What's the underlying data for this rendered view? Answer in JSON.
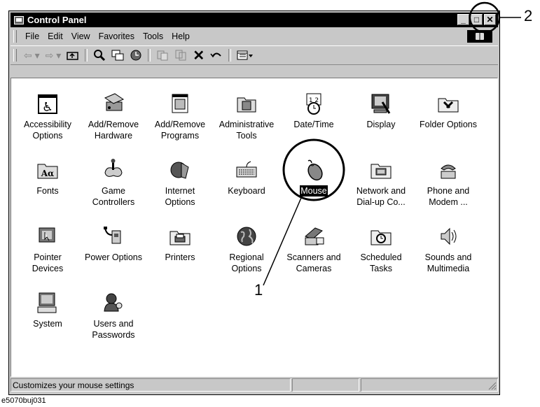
{
  "window": {
    "title": "Control Panel",
    "minimize_glyph": "_",
    "maximize_glyph": "□",
    "close_glyph": "✕"
  },
  "menu": [
    "File",
    "Edit",
    "View",
    "Favorites",
    "Tools",
    "Help"
  ],
  "toolbar": [
    "back-icon",
    "forward-icon",
    "up-folder-icon",
    "search-icon",
    "folders-icon",
    "history-icon",
    "move-to-icon",
    "copy-to-icon",
    "delete-icon",
    "undo-icon",
    "views-icon"
  ],
  "items": [
    {
      "label": "Accessibility\nOptions",
      "icon": "accessibility-icon"
    },
    {
      "label": "Add/Remove\nHardware",
      "icon": "add-hardware-icon"
    },
    {
      "label": "Add/Remove\nPrograms",
      "icon": "add-programs-icon"
    },
    {
      "label": "Administrative\nTools",
      "icon": "admin-tools-icon"
    },
    {
      "label": "Date/Time",
      "icon": "date-time-icon"
    },
    {
      "label": "Display",
      "icon": "display-icon"
    },
    {
      "label": "Folder Options",
      "icon": "folder-options-icon"
    },
    {
      "label": "Fonts",
      "icon": "fonts-icon"
    },
    {
      "label": "Game\nControllers",
      "icon": "game-controller-icon"
    },
    {
      "label": "Internet\nOptions",
      "icon": "internet-options-icon"
    },
    {
      "label": "Keyboard",
      "icon": "keyboard-icon"
    },
    {
      "label": "Mouse",
      "icon": "mouse-icon",
      "selected": true
    },
    {
      "label": "Network and\nDial-up Co...",
      "icon": "network-icon"
    },
    {
      "label": "Phone and\nModem ...",
      "icon": "phone-icon"
    },
    {
      "label": "Pointer\nDevices",
      "icon": "pointer-devices-icon"
    },
    {
      "label": "Power Options",
      "icon": "power-icon"
    },
    {
      "label": "Printers",
      "icon": "printer-icon"
    },
    {
      "label": "Regional\nOptions",
      "icon": "globe-icon"
    },
    {
      "label": "Scanners and\nCameras",
      "icon": "scanner-icon"
    },
    {
      "label": "Scheduled\nTasks",
      "icon": "scheduled-tasks-icon"
    },
    {
      "label": "Sounds and\nMultimedia",
      "icon": "speaker-icon"
    },
    {
      "label": "System",
      "icon": "computer-icon"
    },
    {
      "label": "Users and\nPasswords",
      "icon": "users-icon"
    }
  ],
  "status": {
    "text": "Customizes your mouse settings"
  },
  "callouts": {
    "one": "1",
    "two": "2"
  },
  "caption": "e5070buj031"
}
